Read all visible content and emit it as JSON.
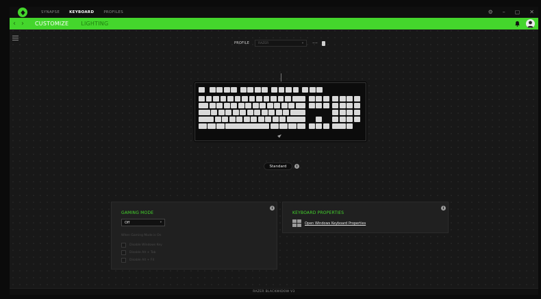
{
  "titlebar": {
    "tabs": [
      {
        "label": "SYNAPSE",
        "active": false
      },
      {
        "label": "KEYBOARD",
        "active": true
      },
      {
        "label": "PROFILES",
        "active": false
      }
    ],
    "controls": {
      "settings": "⚙",
      "minimize": "–",
      "maximize": "▢",
      "close": "✕"
    }
  },
  "navbar": {
    "back": "‹",
    "forward": "›",
    "items": [
      {
        "label": "CUSTOMIZE",
        "active": true
      },
      {
        "label": "LIGHTING",
        "active": false
      }
    ]
  },
  "profile": {
    "label": "PROFILE",
    "value": "RAZER",
    "more": "···"
  },
  "keyboard_mode": {
    "label": "Standard",
    "info": "i"
  },
  "gaming_mode": {
    "title": "GAMING MODE",
    "selected": "Off",
    "caret": "▾",
    "when_label": "When Gaming Mode is On",
    "options": [
      {
        "label": "Disable Windows Key",
        "checked": false
      },
      {
        "label": "Disable Alt + Tab",
        "checked": false
      },
      {
        "label": "Disable Alt + F4",
        "checked": false
      }
    ],
    "info": "i"
  },
  "keyboard_properties": {
    "title": "KEYBOARD PROPERTIES",
    "link": "Open Windows Keyboard Properties",
    "info": "i"
  },
  "footer": {
    "device": "RAZER BLACKWIDOW V3"
  },
  "colors": {
    "accent": "#44d62c",
    "background": "#181818",
    "panel": "#202020"
  }
}
